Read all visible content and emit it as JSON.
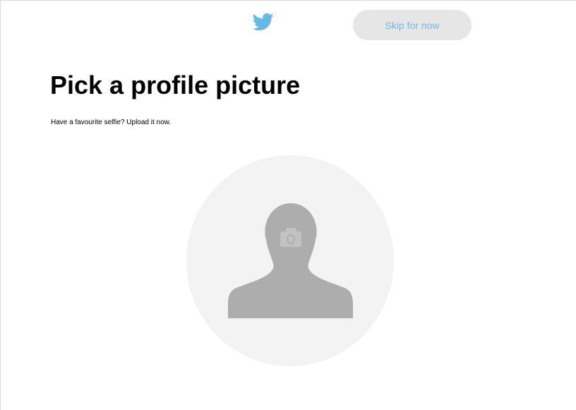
{
  "app": {
    "logo_icon": "twitter-bird-icon",
    "brand_color": "#1DA1F2"
  },
  "header": {
    "skip_label": "Skip for now",
    "skip_text_color": "#71B8E8",
    "skip_bg_color": "#E6E6E6"
  },
  "main": {
    "title": "Pick a profile picture",
    "subtitle": "Have a favourite selfie? Upload it now."
  },
  "avatar": {
    "placeholder_icon": "default-profile-silhouette-icon",
    "upload_icon": "camera-icon",
    "circle_color": "#F3F3F3",
    "silhouette_color": "#ADADAD"
  }
}
